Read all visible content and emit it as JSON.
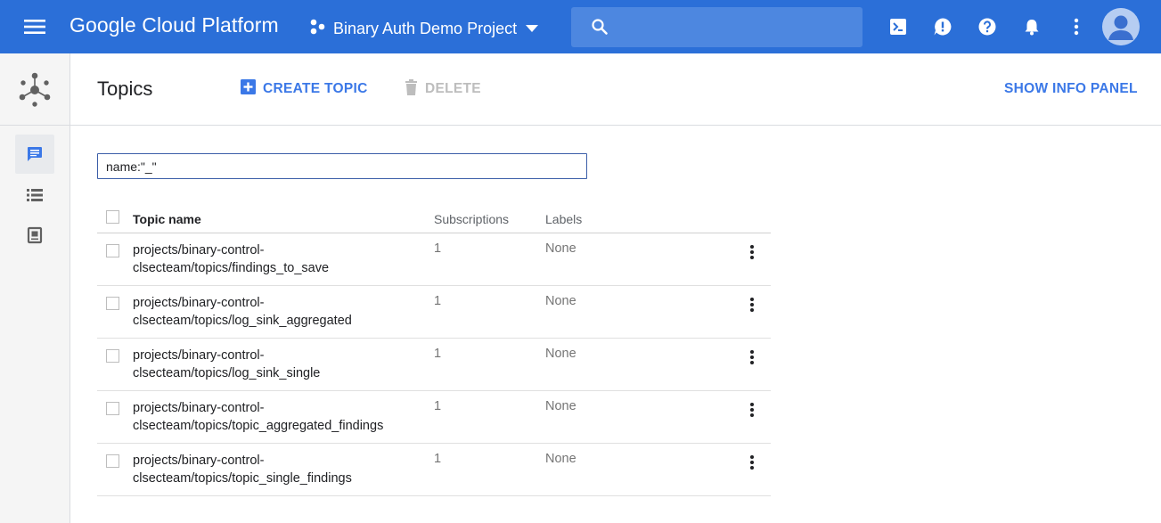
{
  "appbar": {
    "brand": "Google Cloud Platform",
    "project_name": "Binary Auth Demo Project",
    "search_placeholder": "",
    "color": "#2b6fd8"
  },
  "page": {
    "title": "Topics",
    "create_label": "CREATE TOPIC",
    "delete_label": "DELETE",
    "info_panel_label": "SHOW INFO PANEL"
  },
  "filter": {
    "value": "name:\"_\""
  },
  "table": {
    "columns": {
      "topic": "Topic name",
      "subscriptions": "Subscriptions",
      "labels": "Labels"
    },
    "rows": [
      {
        "name_line1": "projects/binary-control-",
        "name_line2": "clsecteam/topics/findings_to_save",
        "subscriptions": "1",
        "labels": "None"
      },
      {
        "name_line1": "projects/binary-control-",
        "name_line2": "clsecteam/topics/log_sink_aggregated",
        "subscriptions": "1",
        "labels": "None"
      },
      {
        "name_line1": "projects/binary-control-",
        "name_line2": "clsecteam/topics/log_sink_single",
        "subscriptions": "1",
        "labels": "None"
      },
      {
        "name_line1": "projects/binary-control-",
        "name_line2": "clsecteam/topics/topic_aggregated_findings",
        "subscriptions": "1",
        "labels": "None"
      },
      {
        "name_line1": "projects/binary-control-",
        "name_line2": "clsecteam/topics/topic_single_findings",
        "subscriptions": "1",
        "labels": "None"
      }
    ]
  },
  "icons": {
    "menu": "hamburger-menu-icon",
    "project": "project-hierarchy-icon",
    "search": "search-icon",
    "shell": "cloud-shell-icon",
    "feedback": "feedback-icon",
    "help": "help-icon",
    "notifications": "bell-icon",
    "more": "more-vert-icon",
    "product": "pubsub-logo-icon",
    "rail": [
      "topics-chat-icon",
      "subscriptions-list-icon",
      "snapshots-icon"
    ]
  }
}
